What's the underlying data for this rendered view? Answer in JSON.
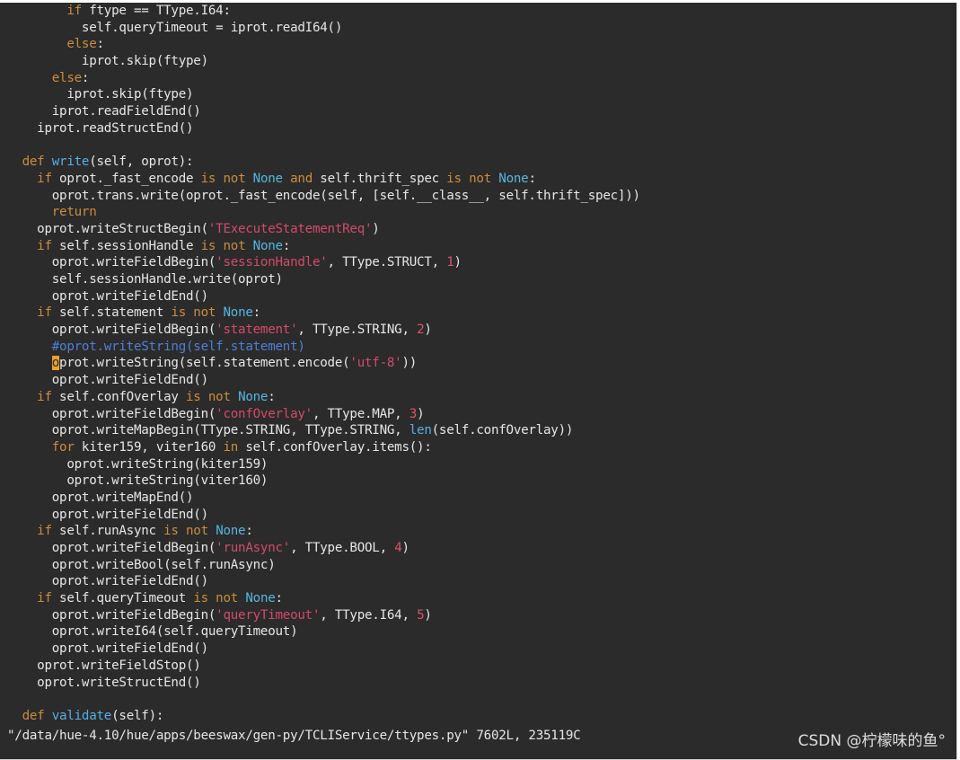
{
  "colors": {
    "background": "#2b2b2b",
    "keyword": "#cc8c3c",
    "string": "#d44a6a",
    "number": "#e0506a",
    "comment": "#4f7fd6",
    "none_constant": "#56b6e0",
    "plain": "#e6e6e6",
    "cursor": "#e8a32a"
  },
  "code_lines": [
    [
      {
        "t": "        "
      },
      {
        "t": "if",
        "c": "kw"
      },
      {
        "t": " ftype == TType.I64:"
      }
    ],
    [
      {
        "t": "          self.queryTimeout = iprot.readI64()"
      }
    ],
    [
      {
        "t": "        "
      },
      {
        "t": "else",
        "c": "kw"
      },
      {
        "t": ":"
      }
    ],
    [
      {
        "t": "          iprot.skip(ftype)"
      }
    ],
    [
      {
        "t": "      "
      },
      {
        "t": "else",
        "c": "kw"
      },
      {
        "t": ":"
      }
    ],
    [
      {
        "t": "        iprot.skip(ftype)"
      }
    ],
    [
      {
        "t": "      iprot.readFieldEnd()"
      }
    ],
    [
      {
        "t": "    iprot.readStructEnd()"
      }
    ],
    [
      {
        "t": ""
      }
    ],
    [
      {
        "t": "  "
      },
      {
        "t": "def",
        "c": "kw"
      },
      {
        "t": " "
      },
      {
        "t": "write",
        "c": "bi"
      },
      {
        "t": "(self, oprot):"
      }
    ],
    [
      {
        "t": "    "
      },
      {
        "t": "if",
        "c": "kw"
      },
      {
        "t": " oprot._fast_encode "
      },
      {
        "t": "is not",
        "c": "kw"
      },
      {
        "t": " "
      },
      {
        "t": "None",
        "c": "nm"
      },
      {
        "t": " "
      },
      {
        "t": "and",
        "c": "kw"
      },
      {
        "t": " self.thrift_spec "
      },
      {
        "t": "is not",
        "c": "kw"
      },
      {
        "t": " "
      },
      {
        "t": "None",
        "c": "nm"
      },
      {
        "t": ":"
      }
    ],
    [
      {
        "t": "      oprot.trans.write(oprot._fast_encode(self, [self.__class__, self.thrift_spec]))"
      }
    ],
    [
      {
        "t": "      "
      },
      {
        "t": "return",
        "c": "kw"
      }
    ],
    [
      {
        "t": "    oprot.writeStructBegin("
      },
      {
        "t": "'TExecuteStatementReq'",
        "c": "str"
      },
      {
        "t": ")"
      }
    ],
    [
      {
        "t": "    "
      },
      {
        "t": "if",
        "c": "kw"
      },
      {
        "t": " self.sessionHandle "
      },
      {
        "t": "is not",
        "c": "kw"
      },
      {
        "t": " "
      },
      {
        "t": "None",
        "c": "nm"
      },
      {
        "t": ":"
      }
    ],
    [
      {
        "t": "      oprot.writeFieldBegin("
      },
      {
        "t": "'sessionHandle'",
        "c": "str"
      },
      {
        "t": ", TType.STRUCT, "
      },
      {
        "t": "1",
        "c": "num"
      },
      {
        "t": ")"
      }
    ],
    [
      {
        "t": "      self.sessionHandle.write(oprot)"
      }
    ],
    [
      {
        "t": "      oprot.writeFieldEnd()"
      }
    ],
    [
      {
        "t": "    "
      },
      {
        "t": "if",
        "c": "kw"
      },
      {
        "t": " self.statement "
      },
      {
        "t": "is not",
        "c": "kw"
      },
      {
        "t": " "
      },
      {
        "t": "None",
        "c": "nm"
      },
      {
        "t": ":"
      }
    ],
    [
      {
        "t": "      oprot.writeFieldBegin("
      },
      {
        "t": "'statement'",
        "c": "str"
      },
      {
        "t": ", TType.STRING, "
      },
      {
        "t": "2",
        "c": "num"
      },
      {
        "t": ")"
      }
    ],
    [
      {
        "t": "      "
      },
      {
        "t": "#oprot.writeString(self.statement)",
        "c": "cm"
      }
    ],
    [
      {
        "t": "      "
      },
      {
        "t": "o",
        "c": "cur"
      },
      {
        "t": "prot.writeString(self.statement.encode("
      },
      {
        "t": "'utf-8'",
        "c": "str"
      },
      {
        "t": "))"
      }
    ],
    [
      {
        "t": "      oprot.writeFieldEnd()"
      }
    ],
    [
      {
        "t": "    "
      },
      {
        "t": "if",
        "c": "kw"
      },
      {
        "t": " self.confOverlay "
      },
      {
        "t": "is not",
        "c": "kw"
      },
      {
        "t": " "
      },
      {
        "t": "None",
        "c": "nm"
      },
      {
        "t": ":"
      }
    ],
    [
      {
        "t": "      oprot.writeFieldBegin("
      },
      {
        "t": "'confOverlay'",
        "c": "str"
      },
      {
        "t": ", TType.MAP, "
      },
      {
        "t": "3",
        "c": "num"
      },
      {
        "t": ")"
      }
    ],
    [
      {
        "t": "      oprot.writeMapBegin(TType.STRING, TType.STRING, "
      },
      {
        "t": "len",
        "c": "bi"
      },
      {
        "t": "(self.confOverlay))"
      }
    ],
    [
      {
        "t": "      "
      },
      {
        "t": "for",
        "c": "kw"
      },
      {
        "t": " kiter159, viter160 "
      },
      {
        "t": "in",
        "c": "kw"
      },
      {
        "t": " self.confOverlay.items():"
      }
    ],
    [
      {
        "t": "        oprot.writeString(kiter159)"
      }
    ],
    [
      {
        "t": "        oprot.writeString(viter160)"
      }
    ],
    [
      {
        "t": "      oprot.writeMapEnd()"
      }
    ],
    [
      {
        "t": "      oprot.writeFieldEnd()"
      }
    ],
    [
      {
        "t": "    "
      },
      {
        "t": "if",
        "c": "kw"
      },
      {
        "t": " self.runAsync "
      },
      {
        "t": "is not",
        "c": "kw"
      },
      {
        "t": " "
      },
      {
        "t": "None",
        "c": "nm"
      },
      {
        "t": ":"
      }
    ],
    [
      {
        "t": "      oprot.writeFieldBegin("
      },
      {
        "t": "'runAsync'",
        "c": "str"
      },
      {
        "t": ", TType.BOOL, "
      },
      {
        "t": "4",
        "c": "num"
      },
      {
        "t": ")"
      }
    ],
    [
      {
        "t": "      oprot.writeBool(self.runAsync)"
      }
    ],
    [
      {
        "t": "      oprot.writeFieldEnd()"
      }
    ],
    [
      {
        "t": "    "
      },
      {
        "t": "if",
        "c": "kw"
      },
      {
        "t": " self.queryTimeout "
      },
      {
        "t": "is not",
        "c": "kw"
      },
      {
        "t": " "
      },
      {
        "t": "None",
        "c": "nm"
      },
      {
        "t": ":"
      }
    ],
    [
      {
        "t": "      oprot.writeFieldBegin("
      },
      {
        "t": "'queryTimeout'",
        "c": "str"
      },
      {
        "t": ", TType.I64, "
      },
      {
        "t": "5",
        "c": "num"
      },
      {
        "t": ")"
      }
    ],
    [
      {
        "t": "      oprot.writeI64(self.queryTimeout)"
      }
    ],
    [
      {
        "t": "      oprot.writeFieldEnd()"
      }
    ],
    [
      {
        "t": "    oprot.writeFieldStop()"
      }
    ],
    [
      {
        "t": "    oprot.writeStructEnd()"
      }
    ],
    [
      {
        "t": ""
      }
    ],
    [
      {
        "t": "  "
      },
      {
        "t": "def",
        "c": "kw"
      },
      {
        "t": " "
      },
      {
        "t": "validate",
        "c": "bi"
      },
      {
        "t": "(self):"
      }
    ]
  ],
  "status_bar": {
    "text": "\"/data/hue-4.10/hue/apps/beeswax/gen-py/TCLIService/ttypes.py\" 7602L, 235119C"
  },
  "watermark": {
    "text": "CSDN @柠檬味的鱼°"
  }
}
